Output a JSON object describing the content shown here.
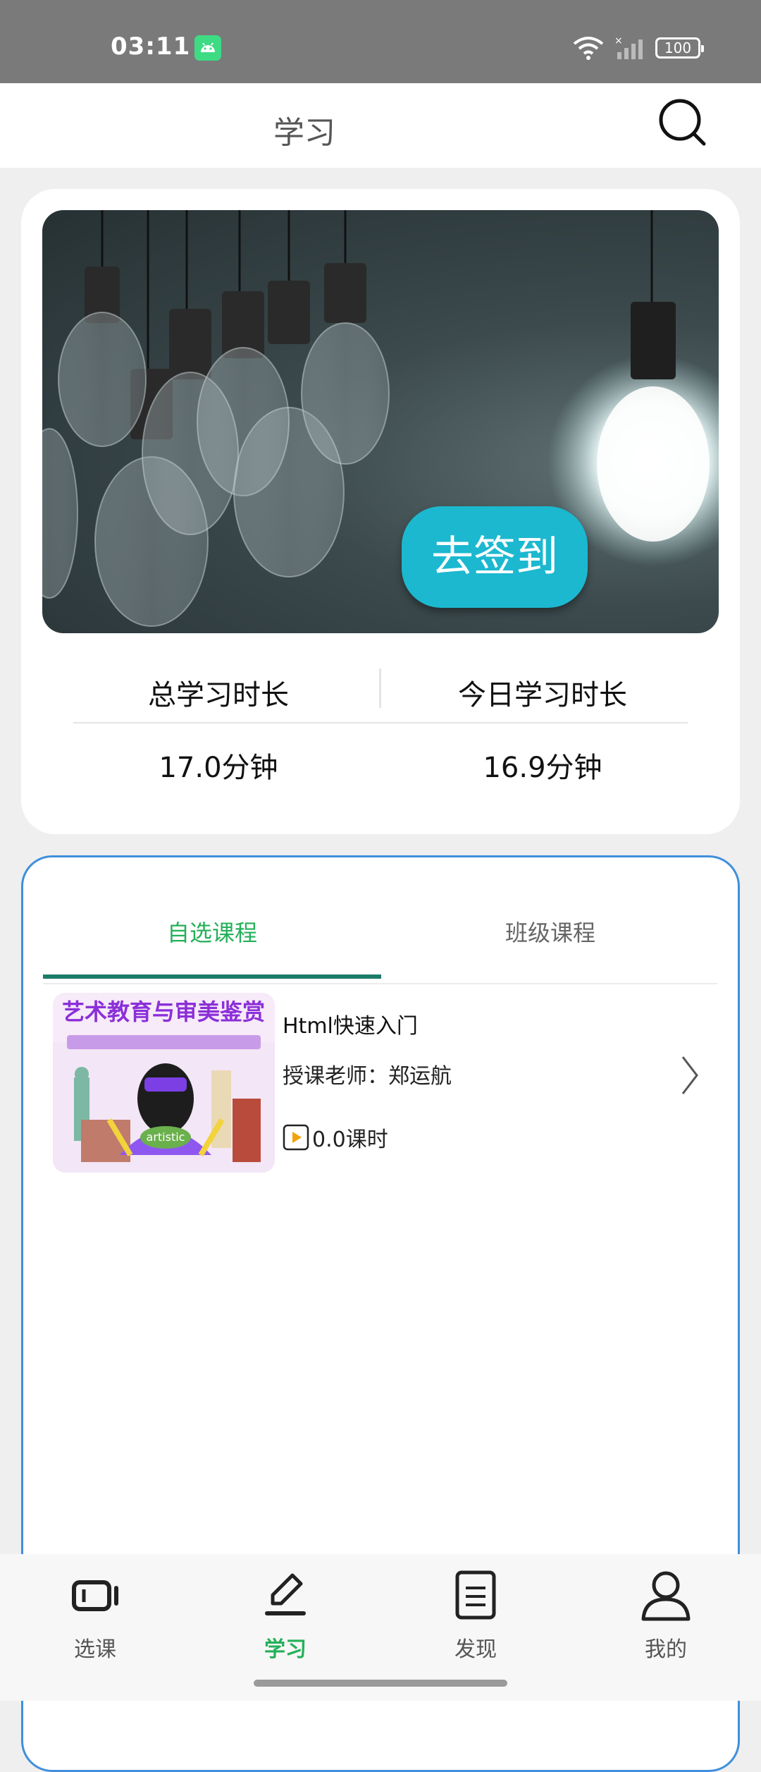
{
  "status_bar": {
    "time": "03:11",
    "battery": "100"
  },
  "header": {
    "title": "学习",
    "search_icon": "search-icon"
  },
  "banner": {
    "checkin_label": "去签到"
  },
  "stats": {
    "total_label": "总学习时长",
    "total_value": "17.0分钟",
    "today_label": "今日学习时长",
    "today_value": "16.9分钟"
  },
  "tabs": [
    {
      "label": "自选课程",
      "active": true
    },
    {
      "label": "班级课程",
      "active": false
    }
  ],
  "courses": [
    {
      "title": "Html快速入门",
      "teacher": "授课老师：郑运航",
      "hours": "0.0课时",
      "thumbnail_text": "艺术教育与审美鉴赏"
    }
  ],
  "bottom_nav": [
    {
      "label": "选课",
      "icon": "course-select-icon",
      "active": false
    },
    {
      "label": "学习",
      "icon": "pencil-icon",
      "active": true
    },
    {
      "label": "发现",
      "icon": "document-icon",
      "active": false
    },
    {
      "label": "我的",
      "icon": "person-icon",
      "active": false
    }
  ],
  "colors": {
    "accent_green": "#25b05a",
    "checkin_button": "#1cb8d0",
    "tab_indicator": "#1c7c68",
    "course_card_border": "#3f8fdb"
  }
}
